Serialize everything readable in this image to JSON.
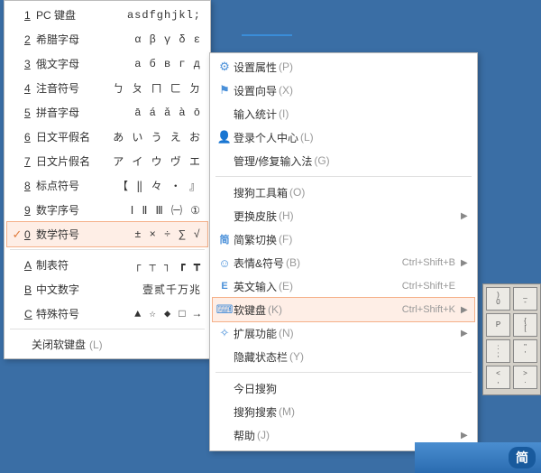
{
  "softkb": {
    "items": [
      {
        "num": "1",
        "label": "PC 键盘",
        "sample": "asdfghjkl;"
      },
      {
        "num": "2",
        "label": "希腊字母",
        "sample": "α β γ δ ε"
      },
      {
        "num": "3",
        "label": "俄文字母",
        "sample": "а б в г д"
      },
      {
        "num": "4",
        "label": "注音符号",
        "sample": "ㄅ ㄆ ㄇ ㄈ ㄉ"
      },
      {
        "num": "5",
        "label": "拼音字母",
        "sample": "ā á ǎ à ō"
      },
      {
        "num": "6",
        "label": "日文平假名",
        "sample": "あ い う え お"
      },
      {
        "num": "7",
        "label": "日文片假名",
        "sample": "ア イ ウ ヴ エ"
      },
      {
        "num": "8",
        "label": "标点符号",
        "sample": "【 ‖ 々 ・ 』"
      },
      {
        "num": "9",
        "label": "数字序号",
        "sample": "Ⅰ Ⅱ Ⅲ ㈠ ①"
      },
      {
        "num": "0",
        "label": "数学符号",
        "sample": "± × ÷ ∑ √"
      },
      {
        "num": "A",
        "label": "制表符",
        "sample": "┌ ┬ ┐ ┏ ┳"
      },
      {
        "num": "B",
        "label": "中文数字",
        "sample": "壹贰千万兆"
      },
      {
        "num": "C",
        "label": "特殊符号",
        "sample": "▲ ☆ ◆ □ →"
      }
    ],
    "active_index": 9,
    "close": {
      "label": "关闭软键盘",
      "accel": "(L)"
    }
  },
  "main_menu": {
    "items": [
      {
        "icon": "gear",
        "label": "设置属性",
        "accel": "(P)"
      },
      {
        "icon": "flag",
        "label": "设置向导",
        "accel": "(X)"
      },
      {
        "icon": "",
        "label": "输入统计",
        "accel": "(I)"
      },
      {
        "icon": "person",
        "label": "登录个人中心",
        "accel": "(L)"
      },
      {
        "icon": "",
        "label": "管理/修复输入法",
        "accel": "(G)"
      },
      {
        "sep": true
      },
      {
        "icon": "",
        "label": "搜狗工具箱",
        "accel": "(O)"
      },
      {
        "icon": "",
        "label": "更换皮肤",
        "accel": "(H)",
        "arrow": true
      },
      {
        "icon": "simp",
        "label": "简繁切换",
        "accel": "(F)"
      },
      {
        "icon": "smile",
        "label": "表情&符号",
        "accel": "(B)",
        "shortcut": "Ctrl+Shift+B",
        "arrow": true
      },
      {
        "icon": "E",
        "label": "英文输入",
        "accel": "(E)",
        "shortcut": "Ctrl+Shift+E"
      },
      {
        "icon": "keyboard",
        "label": "软键盘",
        "accel": "(K)",
        "shortcut": "Ctrl+Shift+K",
        "arrow": true,
        "active": true
      },
      {
        "icon": "puzzle",
        "label": "扩展功能",
        "accel": "(N)",
        "arrow": true
      },
      {
        "icon": "",
        "label": "隐藏状态栏",
        "accel": "(Y)"
      },
      {
        "sep": true
      },
      {
        "icon": "",
        "label": "今日搜狗"
      },
      {
        "icon": "",
        "label": "搜狗搜索",
        "accel": "(M)"
      },
      {
        "icon": "",
        "label": "帮助",
        "accel": "(J)",
        "arrow": true
      }
    ]
  },
  "vk": {
    "rows": [
      [
        {
          "t": ")",
          "b": "0"
        },
        {
          "t": "_",
          "b": "-"
        }
      ],
      [
        {
          "t": "P",
          "b": ""
        },
        {
          "t": "{",
          "b": "["
        }
      ],
      [
        {
          "t": ":",
          "b": ";"
        },
        {
          "t": "\"",
          "b": "'"
        }
      ],
      [
        {
          "t": "<",
          "b": ","
        },
        {
          "t": ">",
          "b": "."
        }
      ]
    ]
  },
  "taskbar": {
    "label": "简"
  }
}
